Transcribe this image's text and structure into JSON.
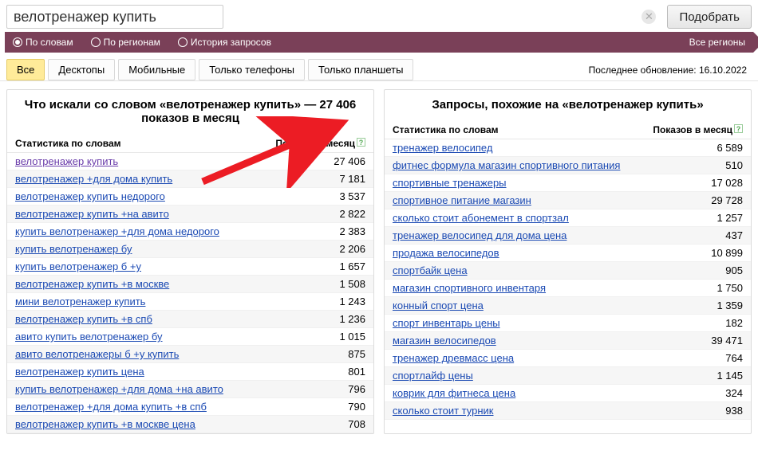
{
  "search": {
    "value": "велотренажер купить",
    "submit_label": "Подобрать"
  },
  "filters": {
    "by_words": "По словам",
    "by_regions": "По регионам",
    "history": "История запросов",
    "all_regions": "Все регионы"
  },
  "tabs": {
    "all": "Все",
    "desktops": "Десктопы",
    "mobiles": "Мобильные",
    "phones_only": "Только телефоны",
    "tablets_only": "Только планшеты"
  },
  "last_update": "Последнее обновление: 16.10.2022",
  "left": {
    "title": "Что искали со словом «велотренажер купить» — 27 406 показов в месяц",
    "th_stat": "Статистика по словам",
    "th_count": "Показов в месяц",
    "rows": [
      {
        "term": "велотренажер купить",
        "count": "27 406",
        "visited": true
      },
      {
        "term": "велотренажер +для дома купить",
        "count": "7 181"
      },
      {
        "term": "велотренажер купить недорого",
        "count": "3 537"
      },
      {
        "term": "велотренажер купить +на авито",
        "count": "2 822"
      },
      {
        "term": "купить велотренажер +для дома недорого",
        "count": "2 383"
      },
      {
        "term": "купить велотренажер бу",
        "count": "2 206"
      },
      {
        "term": "купить велотренажер б +у",
        "count": "1 657"
      },
      {
        "term": "велотренажер купить +в москве",
        "count": "1 508"
      },
      {
        "term": "мини велотренажер купить",
        "count": "1 243"
      },
      {
        "term": "велотренажер купить +в спб",
        "count": "1 236"
      },
      {
        "term": "авито купить велотренажер бу",
        "count": "1 015"
      },
      {
        "term": "авито велотренажеры б +у купить",
        "count": "875"
      },
      {
        "term": "велотренажер купить цена",
        "count": "801"
      },
      {
        "term": "купить велотренажер +для дома +на авито",
        "count": "796"
      },
      {
        "term": "велотренажер +для дома купить +в спб",
        "count": "790"
      },
      {
        "term": "велотренажер купить +в москве цена",
        "count": "708"
      }
    ]
  },
  "right": {
    "title": "Запросы, похожие на «велотренажер купить»",
    "th_stat": "Статистика по словам",
    "th_count": "Показов в месяц",
    "rows": [
      {
        "term": "тренажер велосипед",
        "count": "6 589"
      },
      {
        "term": "фитнес формула магазин спортивного питания",
        "count": "510"
      },
      {
        "term": "спортивные тренажеры",
        "count": "17 028"
      },
      {
        "term": "спортивное питание магазин",
        "count": "29 728"
      },
      {
        "term": "сколько стоит абонемент в спортзал",
        "count": "1 257"
      },
      {
        "term": "тренажер велосипед для дома цена",
        "count": "437"
      },
      {
        "term": "продажа велосипедов",
        "count": "10 899"
      },
      {
        "term": "спортбайк цена",
        "count": "905"
      },
      {
        "term": "магазин спортивного инвентаря",
        "count": "1 750"
      },
      {
        "term": "конный спорт цена",
        "count": "1 359"
      },
      {
        "term": "спорт инвентарь цены",
        "count": "182"
      },
      {
        "term": "магазин велосипедов",
        "count": "39 471"
      },
      {
        "term": "тренажер древмасс цена",
        "count": "764"
      },
      {
        "term": "спортлайф цены",
        "count": "1 145"
      },
      {
        "term": "коврик для фитнеса цена",
        "count": "324"
      },
      {
        "term": "сколько стоит турник",
        "count": "938"
      }
    ]
  }
}
